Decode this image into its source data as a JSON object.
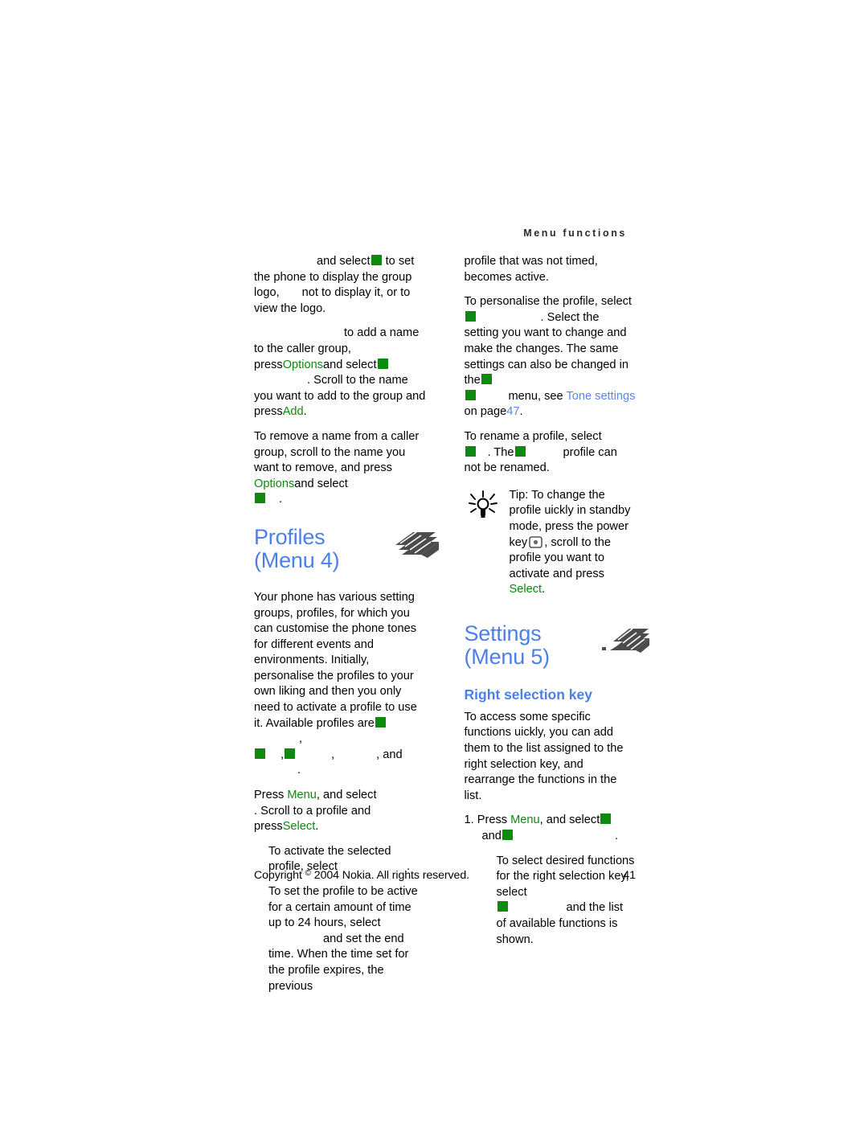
{
  "header": {
    "running_head": "Menu functions"
  },
  "colors": {
    "heading_blue": "#4d7fe8",
    "link_blue": "#5a86ef",
    "key_green": "#0a8a0a",
    "glyph_green": "#0d8a0d",
    "body_text": "#000000"
  },
  "left_column": {
    "p1": {
      "a": "and select",
      "b": "to set the phone to display the group logo,",
      "c": "not to display it, or",
      "d": "to view the logo."
    },
    "p2": {
      "a": "to add a name to the caller group, press",
      "key_options": "Options",
      "b": "and select",
      "c": ". Scroll to the name you want to add to the group and press",
      "key_add": "Add",
      "d": "."
    },
    "p3": {
      "a": "To remove a name from a caller group, scroll to the name you want to remove, and press",
      "key_options": "Options",
      "b": "and select",
      "c": "."
    },
    "section": {
      "title_line1": "Profiles",
      "title_line2": "(Menu 4)",
      "icon": "layered-stack-icon"
    },
    "p4": "Your phone has various setting groups, profiles, for which you can customise the phone tones for different events and environments. Initially, personalise the profiles to your own liking and then you only need to activate a profile to use it. Available profiles are",
    "p4_tail_a": ",",
    "p4_tail_b": ",",
    "p4_tail_c": ",",
    "p4_tail_d": ", and",
    "p4_tail_e": ".",
    "p5": {
      "a": "Press",
      "key_menu": "Menu",
      "b": ", and select",
      "c": ". Scroll to a profile and press",
      "key_select": "Select",
      "d": "."
    },
    "b1": {
      "a": "To activate the selected profile, select",
      "b": "."
    },
    "b2": {
      "a": "To set the profile to be active for a certain amount of time up to 24 hours, select",
      "b": "and set the end time. When the time set for the profile expires, the previous"
    }
  },
  "right_column": {
    "p1": "profile that was not timed, becomes active.",
    "p2": {
      "a": "To personalise the profile, select",
      "b": ". Select the setting you want to change and make the changes. The same settings can also be changed in the",
      "c": "menu, see",
      "link_text": "Tone settings",
      "d": "on page",
      "link_page": "47",
      "e": "."
    },
    "p3": {
      "a": "To rename a profile, select",
      "b": ". The",
      "c": "profile can not be renamed."
    },
    "tip": {
      "icon": "lightbulb-icon",
      "label": "Tip:",
      "a": "To change the profile",
      "b": "uickly in standby mode, press the power key",
      "key_icon": "power-key-icon",
      "c": ", scroll to the profile you want to activate and press",
      "key_select": "Select",
      "d": "."
    },
    "section": {
      "title_line1": "Settings",
      "title_line2": "(Menu 5)",
      "icon": "layered-stack-icon"
    },
    "subheading": "Right selection key",
    "p4": "To access some specific functions  uickly, you can add them to the list assigned to the right selection key, and rearrange the functions in the list.",
    "step1": {
      "num": "1.",
      "a": "Press",
      "key_menu": "Menu",
      "b": ", and select",
      "c": "and",
      "d": "."
    },
    "b1": {
      "a": "To select desired functions for the right selection key, select",
      "b": "and the list of available functions is shown."
    }
  },
  "footer": {
    "copyright_pre": "Copyright",
    "copyright_sym": "©",
    "copyright_post": "2004 Nokia. All rights reserved.",
    "page_number": "41"
  }
}
